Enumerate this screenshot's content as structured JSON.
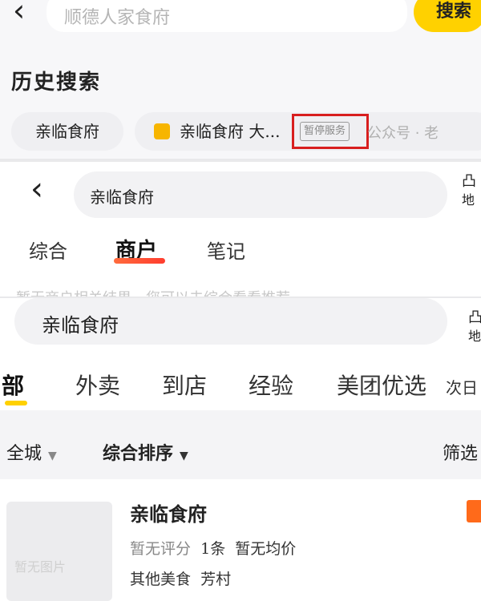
{
  "panel1": {
    "search_text": "顺德人家食府",
    "search_button": "搜索",
    "history_title": "历史搜索",
    "chip1": "亲临食府",
    "chip2_text": "亲临食府 大...",
    "chip2_badge": "暂停服务",
    "watermark": "公众号 · 老"
  },
  "panel2": {
    "search_text": "亲临食府",
    "right_edge_chars": [
      "凸",
      "地"
    ],
    "tabs": [
      "综合",
      "商户",
      "笔记"
    ],
    "active_tab": "商户",
    "truncated_line": "暂无商户相关结果，您可以去综合看看推荐"
  },
  "panel3": {
    "search_text": "亲临食府",
    "right_edge_chars": [
      "凸",
      "地"
    ],
    "tabs": [
      "部",
      "外卖",
      "到店",
      "经验",
      "美团优选",
      "次日"
    ],
    "filters": [
      "全城",
      "综合排序",
      "筛选"
    ],
    "result": {
      "thumb_label": "暂无图片",
      "name": "亲临食府",
      "rating": "暂无评分",
      "reviews": "1条",
      "avg_price": "暂无均价",
      "category": "其他美食",
      "area": "芳村"
    }
  }
}
